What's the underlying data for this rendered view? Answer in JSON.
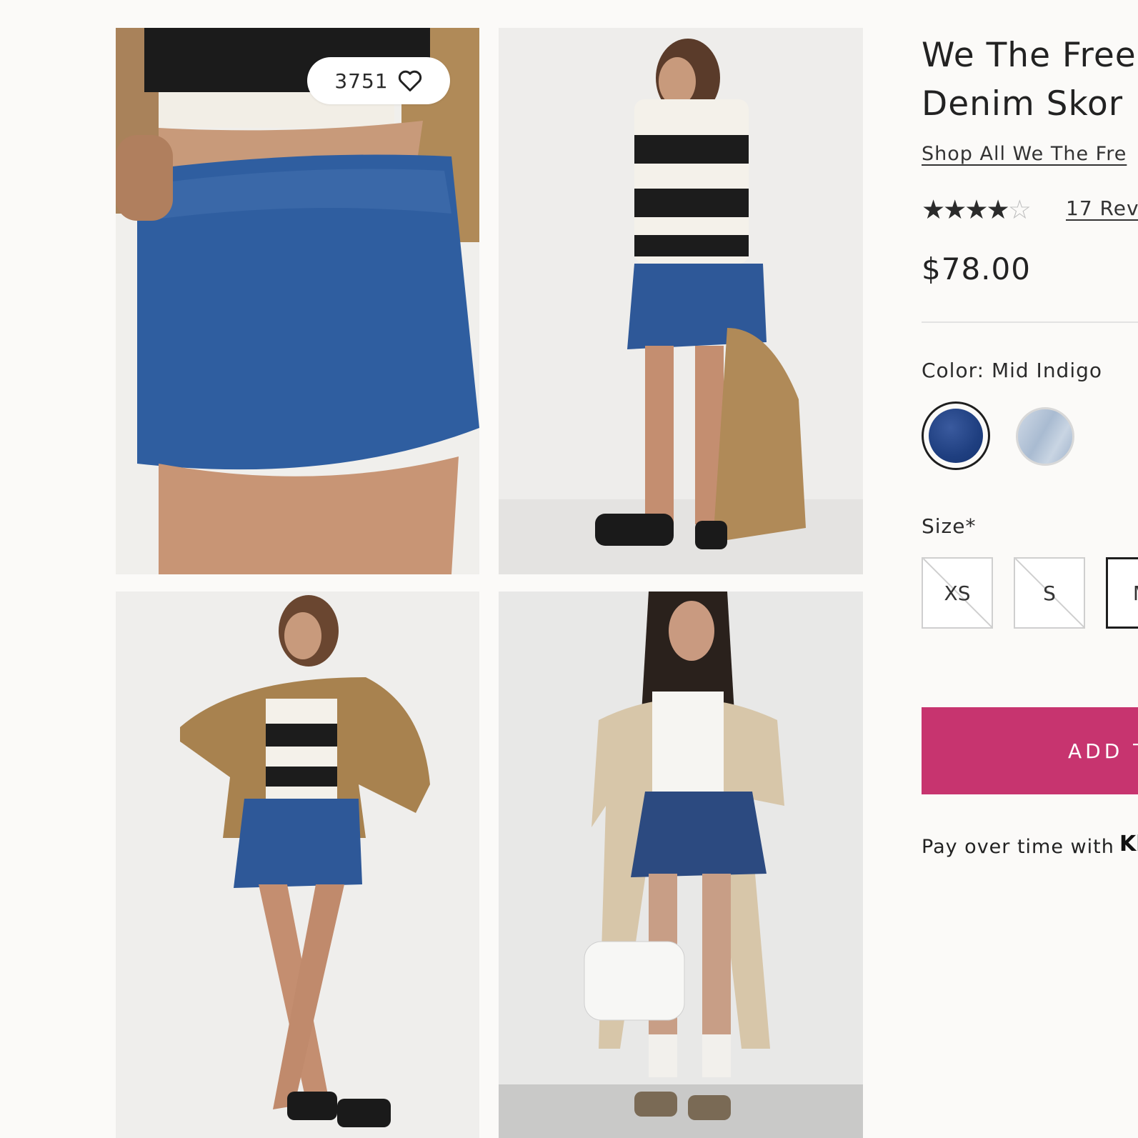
{
  "gallery": {
    "favorites_count": "3751",
    "images": [
      {
        "description": "close-up of denim skort front"
      },
      {
        "description": "model back view in striped polo and denim skort"
      },
      {
        "description": "model in tan jacket and denim skort"
      },
      {
        "description": "model in trench and denim skort holding white bag"
      }
    ]
  },
  "product": {
    "title_line1": "We The Free",
    "title_line2": "Denim Skor",
    "shop_all_label": "Shop All We The Fre",
    "rating_stars": "★★★★",
    "rating_star_empty": "☆",
    "rating": 4.5,
    "reviews_label": "17 Revi",
    "price": "$78.00",
    "color_label": "Color: Mid Indigo",
    "colors": [
      {
        "name": "Mid Indigo",
        "hex": "#1f3f80",
        "selected": true
      },
      {
        "name": "Light",
        "hex": "#b4c4d8",
        "selected": false
      }
    ],
    "size_label": "Size*",
    "sizes": [
      {
        "label": "XS",
        "available": false
      },
      {
        "label": "S",
        "available": false
      },
      {
        "label": "M",
        "available": true,
        "selected": true
      }
    ],
    "add_to_bag_label": "ADD T",
    "pay_label": "Pay over time with",
    "pay_brand": "Kl",
    "accent_color": "#c7346f"
  }
}
